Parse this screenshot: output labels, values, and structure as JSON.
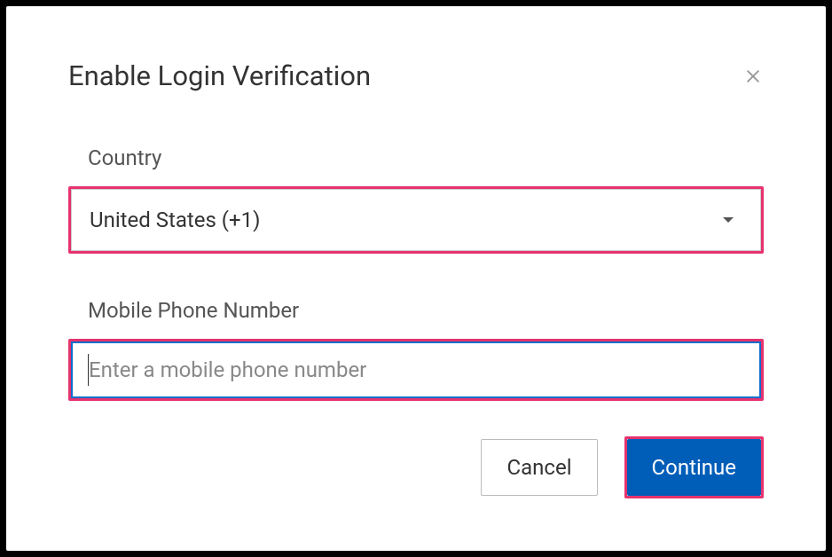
{
  "dialog": {
    "title": "Enable Login Verification"
  },
  "form": {
    "country_label": "Country",
    "country_value": "United States (+1)",
    "phone_label": "Mobile Phone Number",
    "phone_value": "",
    "phone_placeholder": "Enter a mobile phone number"
  },
  "buttons": {
    "cancel": "Cancel",
    "continue": "Continue"
  }
}
